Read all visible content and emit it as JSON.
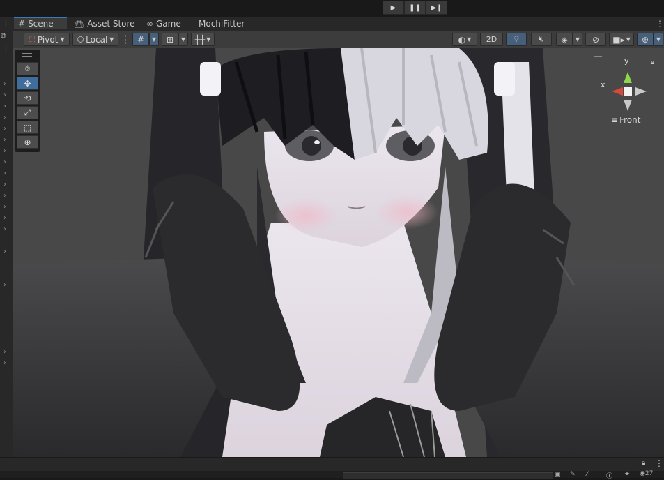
{
  "playbar": {
    "play_icon": "play-icon",
    "pause_icon": "pause-icon",
    "step_icon": "step-icon"
  },
  "tabs": [
    {
      "label": "Scene",
      "icon": "grid-icon"
    },
    {
      "label": "Asset Store",
      "icon": "shopping-bag-icon"
    },
    {
      "label": "Game",
      "icon": "gamepad-icon"
    },
    {
      "label": "MochiFitter",
      "icon": ""
    }
  ],
  "toolbar": {
    "pivot_label": "Pivot",
    "local_label": "Local",
    "mode_2d_label": "2D"
  },
  "gizmo": {
    "y_label": "y",
    "x_label": "x",
    "view_label": "Front"
  },
  "colors": {
    "accent": "#3a79bb",
    "active_tool": "#3f6e9e",
    "gizmo_x": "#d6493a",
    "gizmo_y": "#8ed64a"
  },
  "statusbar": {
    "counter": "27"
  }
}
